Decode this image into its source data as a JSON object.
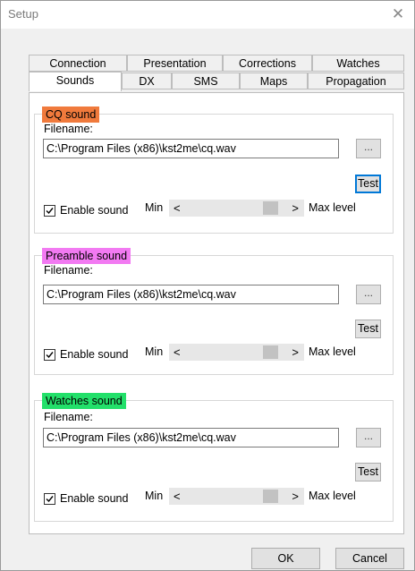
{
  "window": {
    "title": "Setup",
    "close_symbol": "✕"
  },
  "tabs_row1": [
    "Connection",
    "Presentation",
    "Corrections",
    "Watches"
  ],
  "tabs_row2": [
    "Sounds",
    "DX",
    "SMS",
    "Maps",
    "Propagation"
  ],
  "active_tab": "Sounds",
  "groups": [
    {
      "title": "CQ sound",
      "title_color": "#f07a3c",
      "filename_label": "Filename:",
      "filename_value": "C:\\Program Files (x86)\\kst2me\\cq.wav",
      "browse_label": "...",
      "test_label": "Test",
      "enable_label": "Enable sound",
      "enable_checked": true,
      "min_label": "Min",
      "max_label": "Max level",
      "level_fraction": 0.85
    },
    {
      "title": "Preamble sound",
      "title_color": "#f27af2",
      "filename_label": "Filename:",
      "filename_value": "C:\\Program Files (x86)\\kst2me\\cq.wav",
      "browse_label": "...",
      "test_label": "Test",
      "enable_label": "Enable sound",
      "enable_checked": true,
      "min_label": "Min",
      "max_label": "Max level",
      "level_fraction": 0.85
    },
    {
      "title": "Watches sound",
      "title_color": "#22e06a",
      "filename_label": "Filename:",
      "filename_value": "C:\\Program Files (x86)\\kst2me\\cq.wav",
      "browse_label": "...",
      "test_label": "Test",
      "enable_label": "Enable sound",
      "enable_checked": true,
      "min_label": "Min",
      "max_label": "Max level",
      "level_fraction": 0.85
    }
  ],
  "scroll_arrows": {
    "left": "<",
    "right": ">"
  },
  "buttons": {
    "ok": "OK",
    "cancel": "Cancel"
  }
}
